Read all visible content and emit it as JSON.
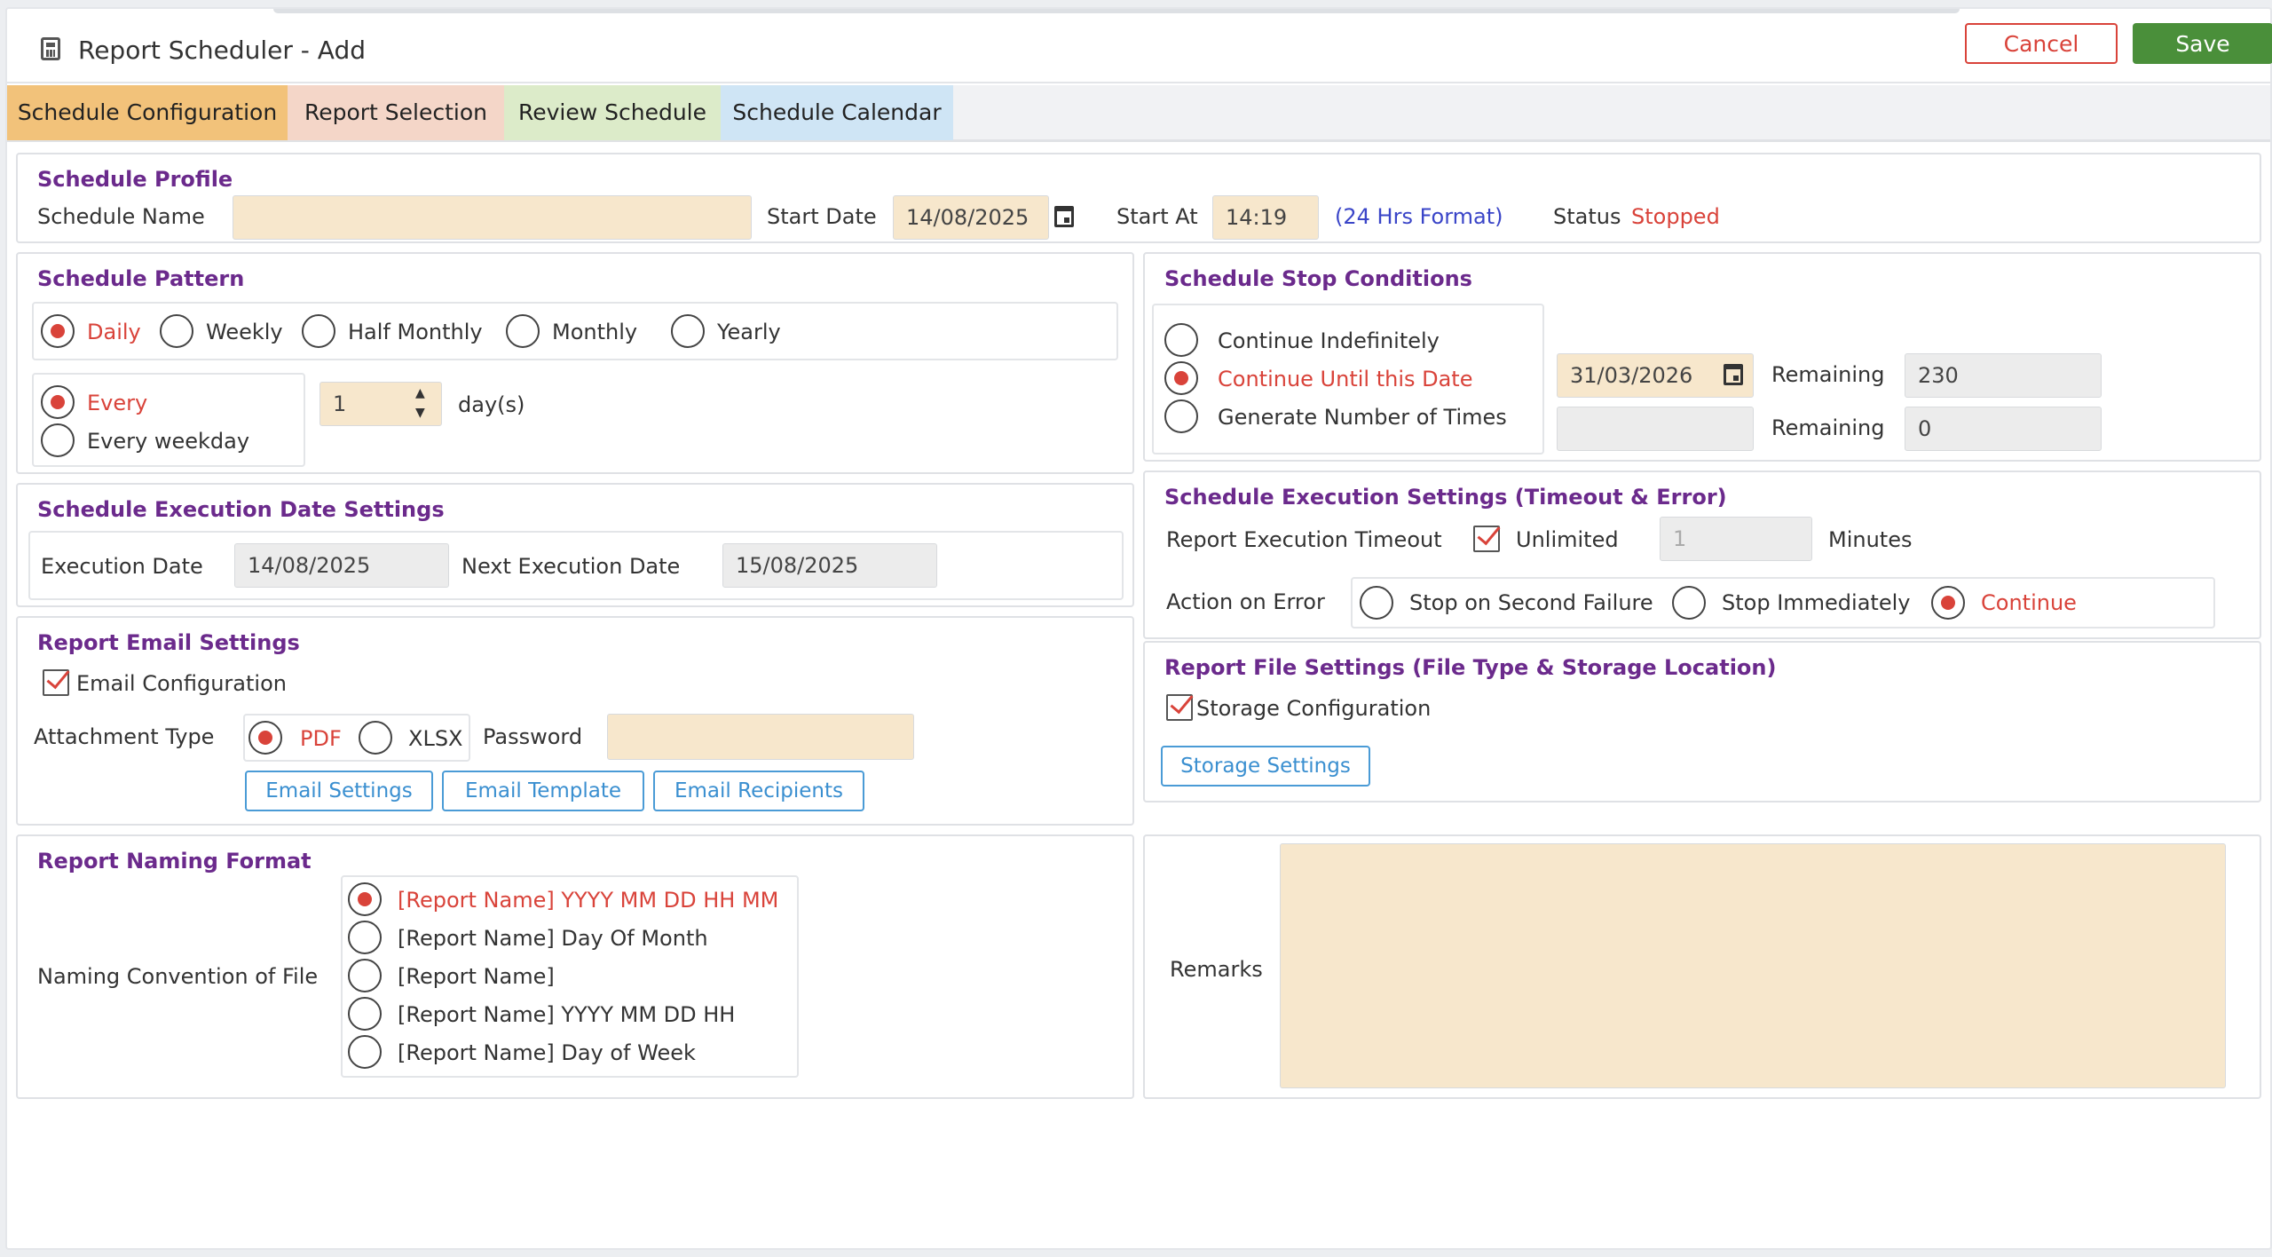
{
  "header": {
    "title": "Report Scheduler - Add",
    "cancel_label": "Cancel",
    "save_label": "Save"
  },
  "tabs": [
    "Schedule Configuration",
    "Report Selection",
    "Review Schedule",
    "Schedule Calendar"
  ],
  "profile": {
    "title": "Schedule Profile",
    "name_label": "Schedule Name",
    "name_value": "",
    "start_date_label": "Start Date",
    "start_date": "14/08/2025",
    "start_at_label": "Start At",
    "start_at": "14:19",
    "format_hint": "(24 Hrs Format)",
    "status_label": "Status",
    "status_value": "Stopped"
  },
  "pattern": {
    "title": "Schedule Pattern",
    "options": [
      "Daily",
      "Weekly",
      "Half Monthly",
      "Monthly",
      "Yearly"
    ],
    "selected": "Daily",
    "every_label": "Every",
    "every_weekday_label": "Every weekday",
    "every_value": "1",
    "unit": "day(s)"
  },
  "stop": {
    "title": "Schedule Stop Conditions",
    "options": [
      "Continue Indefinitely",
      "Continue Until this Date",
      "Generate Number of Times"
    ],
    "selected": "Continue Until this Date",
    "until_date": "31/03/2026",
    "remaining_label": "Remaining",
    "remaining_days": "230",
    "times_value": "",
    "remaining_times": "0"
  },
  "execution_date": {
    "title": "Schedule Execution Date Settings",
    "exec_label": "Execution Date",
    "exec_value": "14/08/2025",
    "next_label": "Next Execution Date",
    "next_value": "15/08/2025"
  },
  "execution_settings": {
    "title": "Schedule Execution Settings (Timeout & Error)",
    "timeout_label": "Report Execution Timeout",
    "unlimited_label": "Unlimited",
    "timeout_value": "1",
    "minutes_label": "Minutes",
    "error_label": "Action on Error",
    "error_options": [
      "Stop on Second Failure",
      "Stop Immediately",
      "Continue"
    ],
    "error_selected": "Continue"
  },
  "email": {
    "title": "Report Email Settings",
    "config_label": "Email Configuration",
    "attachment_label": "Attachment Type",
    "attachment_options": [
      "PDF",
      "XLSX"
    ],
    "attachment_selected": "PDF",
    "password_label": "Password",
    "password_value": "",
    "buttons": [
      "Email Settings",
      "Email Template",
      "Email Recipients"
    ]
  },
  "file": {
    "title": "Report File Settings (File Type & Storage Location)",
    "config_label": "Storage Configuration",
    "storage_button": "Storage Settings"
  },
  "naming": {
    "title": "Report Naming Format",
    "label": "Naming Convention of File",
    "options": [
      "[Report Name] YYYY MM DD HH MM",
      "[Report Name] Day Of Month",
      "[Report Name]",
      "[Report Name] YYYY MM DD HH",
      "[Report Name] Day of Week"
    ],
    "selected": "[Report Name] YYYY MM DD HH MM"
  },
  "remarks": {
    "label": "Remarks",
    "value": ""
  },
  "colors": {
    "accent_red": "#d9433a",
    "section_title": "#6b2a8c",
    "save_green": "#4a8f3a",
    "input_fill": "#f7e7cc"
  }
}
